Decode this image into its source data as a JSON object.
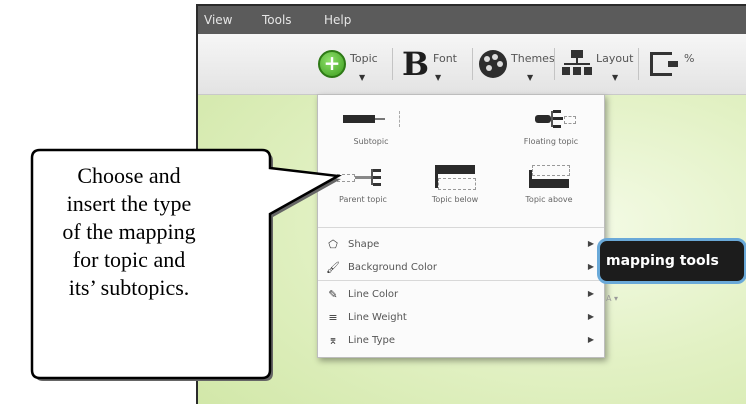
{
  "menubar": {
    "items": [
      "View",
      "Tools",
      "Help"
    ]
  },
  "toolbar": {
    "topic_label": "Topic",
    "font_label": "Font",
    "themes_label": "Themes",
    "layout_label": "Layout",
    "next_label": "%"
  },
  "topic_menu": {
    "types": [
      {
        "label": "Subtopic",
        "icon": "subtopic-icon"
      },
      {
        "label": "Floating topic",
        "icon": "floating-topic-icon"
      },
      {
        "label": "Parent topic",
        "icon": "parent-topic-icon"
      },
      {
        "label": "Topic below",
        "icon": "topic-below-icon"
      },
      {
        "label": "Topic above",
        "icon": "topic-above-icon"
      }
    ],
    "items": [
      {
        "label": "Shape",
        "icon": "shape-icon"
      },
      {
        "label": "Background Color",
        "icon": "background-color-icon"
      },
      {
        "label": "Line Color",
        "icon": "line-color-icon"
      },
      {
        "label": "Line Weight",
        "icon": "line-weight-icon"
      },
      {
        "label": "Line Type",
        "icon": "line-type-icon"
      }
    ]
  },
  "canvas": {
    "topic_text": "mapping tools",
    "small_control": "A ▾"
  },
  "callout": {
    "lines": [
      "Choose and",
      "insert the type",
      "of the mapping",
      "for topic and",
      "its’ subtopics."
    ]
  }
}
